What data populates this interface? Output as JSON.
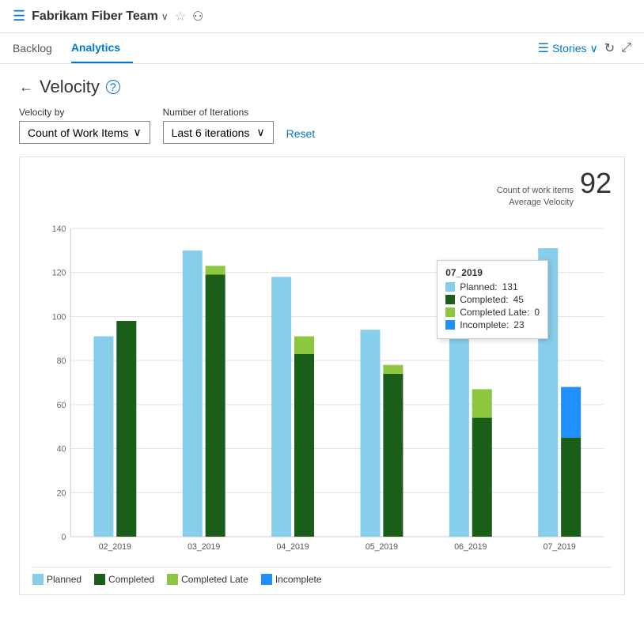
{
  "header": {
    "icon": "☰",
    "team_name": "Fabrikam Fiber Team",
    "chevron": "∨",
    "star": "☆",
    "people_icon": "⚇"
  },
  "nav": {
    "tabs": [
      {
        "id": "backlog",
        "label": "Backlog",
        "active": false
      },
      {
        "id": "analytics",
        "label": "Analytics",
        "active": true
      }
    ],
    "stories_label": "Stories",
    "refresh_title": "Refresh",
    "expand_title": "Expand"
  },
  "page": {
    "back_label": "←",
    "title": "Velocity",
    "help_label": "?",
    "velocity_by_label": "Velocity by",
    "velocity_by_value": "Count of Work Items",
    "number_of_iterations_label": "Number of Iterations",
    "number_of_iterations_value": "Last 6 iterations",
    "reset_label": "Reset"
  },
  "chart": {
    "count_label": "Count of work items",
    "avg_velocity_label": "Average Velocity",
    "avg_velocity_value": "92",
    "y_axis_max": 140,
    "y_axis_ticks": [
      0,
      20,
      40,
      60,
      80,
      100,
      120,
      140
    ],
    "colors": {
      "planned": "#87ceeb",
      "completed": "#1a5e1a",
      "completed_late": "#8dc63f",
      "incomplete": "#1e90ff"
    },
    "bars": [
      {
        "label": "02_2019",
        "planned": 91,
        "completed": 98,
        "completed_late": 0,
        "incomplete": 0
      },
      {
        "label": "03_2019",
        "planned": 130,
        "completed": 119,
        "completed_late": 4,
        "incomplete": 0
      },
      {
        "label": "04_2019",
        "planned": 118,
        "completed": 83,
        "completed_late": 8,
        "incomplete": 0
      },
      {
        "label": "05_2019",
        "planned": 94,
        "completed": 74,
        "completed_late": 4,
        "incomplete": 0
      },
      {
        "label": "06_2019",
        "planned": 91,
        "completed": 54,
        "completed_late": 13,
        "incomplete": 0
      },
      {
        "label": "07_2019",
        "planned": 131,
        "completed": 45,
        "completed_late": 0,
        "incomplete": 23
      }
    ],
    "tooltip": {
      "title": "07_2019",
      "planned_label": "Planned:",
      "planned_value": "131",
      "completed_label": "Completed:",
      "completed_value": "45",
      "completed_late_label": "Completed Late:",
      "completed_late_value": "0",
      "incomplete_label": "Incomplete:",
      "incomplete_value": "23"
    },
    "legend": [
      {
        "id": "planned",
        "label": "Planned",
        "color": "#87ceeb"
      },
      {
        "id": "completed",
        "label": "Completed",
        "color": "#1a5e1a"
      },
      {
        "id": "completed_late",
        "label": "Completed Late",
        "color": "#8dc63f"
      },
      {
        "id": "incomplete",
        "label": "Incomplete",
        "color": "#1e90ff"
      }
    ]
  }
}
